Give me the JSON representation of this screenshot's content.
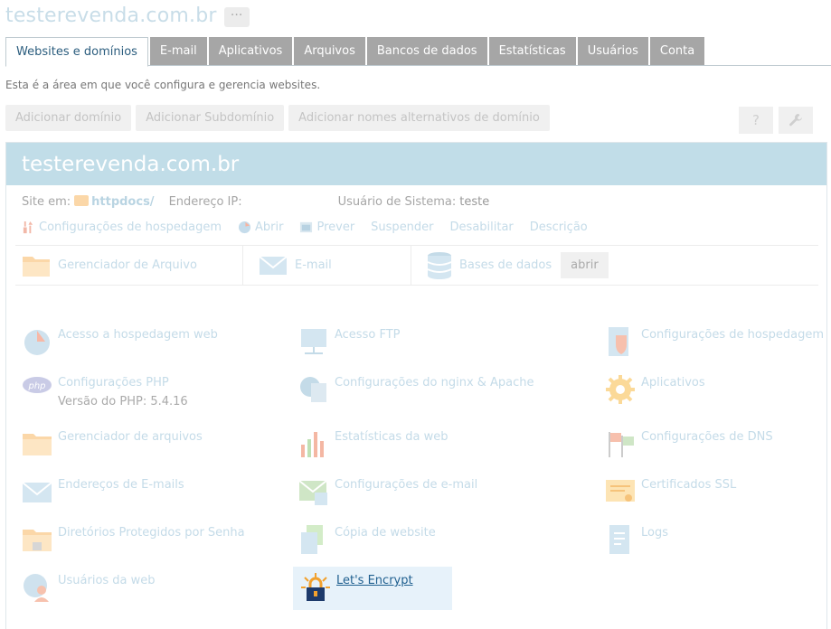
{
  "header": {
    "title": "testerevenda.com.br",
    "more_label": "···"
  },
  "tabs": [
    {
      "label": "Websites e domínios",
      "active": true
    },
    {
      "label": "E-mail"
    },
    {
      "label": "Aplicativos"
    },
    {
      "label": "Arquivos"
    },
    {
      "label": "Bancos de dados"
    },
    {
      "label": "Estatísticas"
    },
    {
      "label": "Usuários"
    },
    {
      "label": "Conta"
    }
  ],
  "intro": "Esta é a área em que você configura e gerencia websites.",
  "toolbar": {
    "add_domain": "Adicionar domínio",
    "add_subdomain": "Adicionar Subdomínio",
    "add_alias": "Adicionar nomes alternativos de domínio",
    "help_icon": "?",
    "tools_icon": "wrench-icon"
  },
  "panel": {
    "title": "testerevenda.com.br",
    "site_label": "Site em:",
    "site_link": "httpdocs/",
    "ip_label": "Endereço IP:",
    "user_label": "Usuário de Sistema:",
    "user_value": "teste"
  },
  "actions": {
    "hosting": "Configurações de hospedagem",
    "open": "Abrir",
    "preview": "Prever",
    "suspend": "Suspender",
    "disable": "Desabilitar",
    "description": "Descrição"
  },
  "quick": {
    "file_manager": "Gerenciador de Arquivo",
    "email": "E-mail",
    "databases": "Bases de dados",
    "open": "abrir"
  },
  "features": {
    "web_access": "Acesso a hospedagem web",
    "ftp": "Acesso FTP",
    "hosting": "Configurações de hospedagem",
    "php": "Configurações PHP",
    "php_version": "Versão do PHP: 5.4.16",
    "nginx": "Configurações do nginx & Apache",
    "apps": "Aplicativos",
    "file_manager": "Gerenciador de arquivos",
    "web_stats": "Estatísticas da web",
    "dns": "Configurações de DNS",
    "email_addresses": "Endereços de E-mails",
    "mail_settings": "Configurações de e-mail",
    "ssl": "Certificados SSL",
    "protected_dirs": "Diretórios Protegidos por Senha",
    "copy_site": "Cópia de website",
    "logs": "Logs",
    "web_users": "Usuários da web",
    "letsencrypt": "Let's Encrypt"
  }
}
